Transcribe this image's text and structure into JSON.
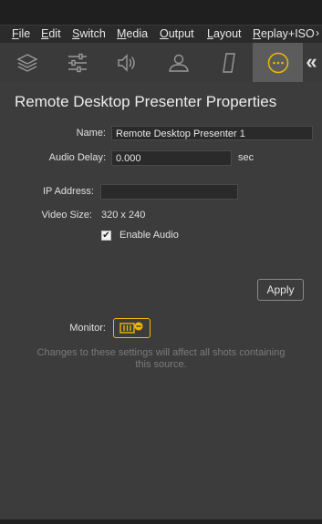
{
  "menu": {
    "items": [
      {
        "first": "F",
        "rest": "ile"
      },
      {
        "first": "E",
        "rest": "dit"
      },
      {
        "first": "S",
        "rest": "witch"
      },
      {
        "first": "M",
        "rest": "edia"
      },
      {
        "first": "O",
        "rest": "utput"
      },
      {
        "first": "L",
        "rest": "ayout"
      },
      {
        "first": "R",
        "rest": "eplay+ISO"
      }
    ]
  },
  "toolbar": {
    "icons": [
      "layers-icon",
      "sliders-icon",
      "speaker-icon",
      "person-icon",
      "slash-card-icon",
      "more-options-icon"
    ],
    "collapse_glyph": "«",
    "accent": "#f0b800"
  },
  "properties": {
    "title": "Remote Desktop Presenter Properties",
    "name_label": "Name:",
    "name_value": "Remote Desktop Presenter 1",
    "audio_delay_label": "Audio Delay:",
    "audio_delay_value": "0.000",
    "audio_delay_unit": "sec",
    "ip_label": "IP Address:",
    "ip_value": "",
    "video_size_label": "Video Size:",
    "video_size_value": "320 x 240",
    "enable_audio_label": "Enable Audio",
    "enable_audio_checked": "✔",
    "apply_label": "Apply",
    "monitor_label": "Monitor:",
    "note": "Changes to these settings will affect all shots containing this source."
  }
}
